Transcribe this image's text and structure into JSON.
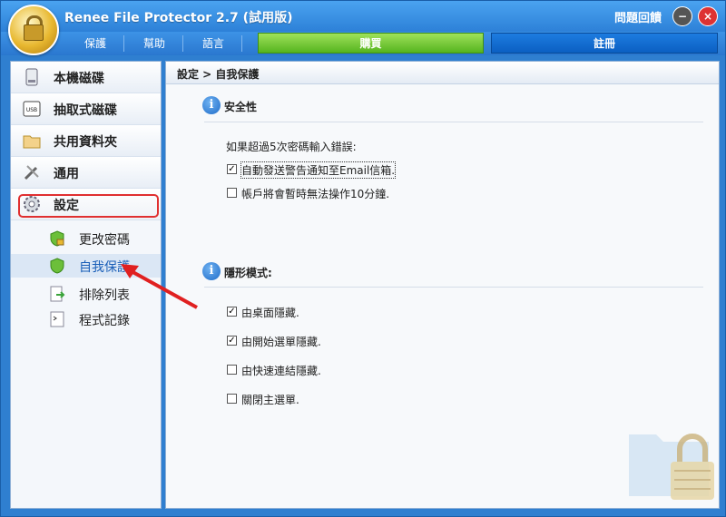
{
  "window": {
    "title": "Renee File Protector 2.7 (試用版)",
    "feedback": "問題回饋",
    "minimize": "−",
    "close": "×"
  },
  "menu": {
    "items": [
      "保護",
      "幫助",
      "語言"
    ],
    "buy": "購買",
    "register": "註冊"
  },
  "sidebar": {
    "items": [
      {
        "label": "本機磁碟",
        "icon": "hard-disk-icon"
      },
      {
        "label": "抽取式磁碟",
        "icon": "usb-drive-icon"
      },
      {
        "label": "共用資料夾",
        "icon": "shared-folder-icon"
      },
      {
        "label": "通用",
        "icon": "tools-icon"
      },
      {
        "label": "設定",
        "icon": "gear-icon"
      }
    ],
    "subitems": [
      {
        "label": "更改密碼",
        "icon": "shield-lock-icon"
      },
      {
        "label": "自我保護",
        "icon": "shield-icon"
      },
      {
        "label": "排除列表",
        "icon": "exclude-list-icon"
      },
      {
        "label": "程式記錄",
        "icon": "log-icon"
      }
    ]
  },
  "main": {
    "breadcrumb": "設定 > 自我保護",
    "security": {
      "title": "安全性",
      "prompt": "如果超過5次密碼輸入錯誤:",
      "options": [
        {
          "label": "自動發送警告通知至Email信箱.",
          "checked": true
        },
        {
          "label": "帳戶將會暫時無法操作10分鐘.",
          "checked": false
        }
      ]
    },
    "stealth": {
      "title": "隱形模式:",
      "options": [
        {
          "label": "由桌面隱藏.",
          "checked": true
        },
        {
          "label": "由開始選單隱藏.",
          "checked": true
        },
        {
          "label": "由快速連結隱藏.",
          "checked": false
        },
        {
          "label": "關閉主選單.",
          "checked": false
        }
      ]
    }
  },
  "icon_glyphs": {
    "info": "i",
    "check": "✓"
  },
  "colors": {
    "accent": "#2f7fd0",
    "buy": "#55b41f",
    "register": "#0b5fc2",
    "highlight": "#e03030"
  }
}
